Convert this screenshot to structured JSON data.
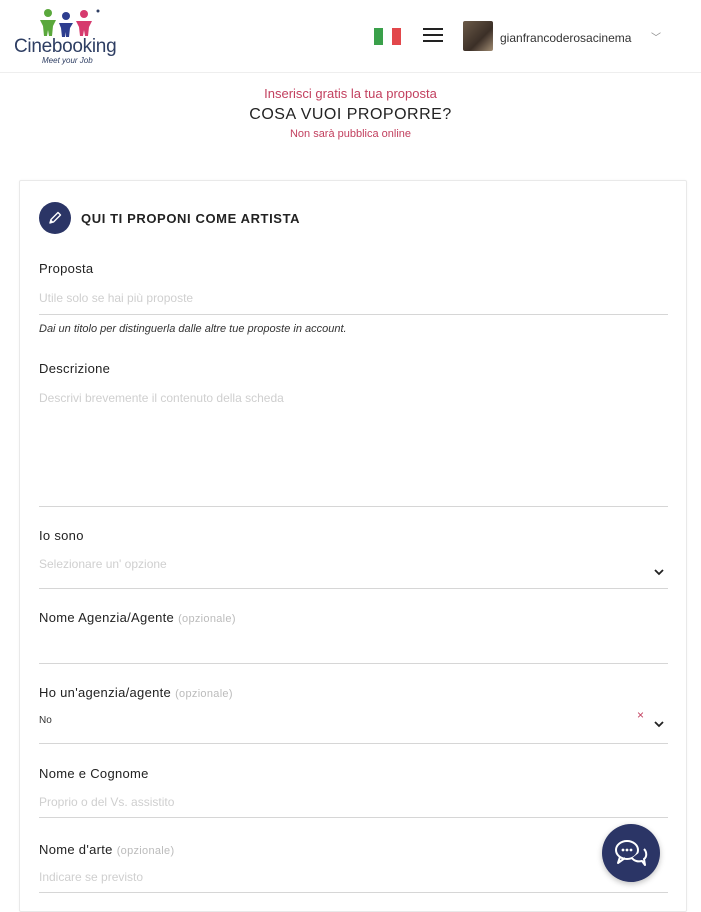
{
  "header": {
    "logo_text": "Cinebooking",
    "logo_tagline": "Meet your Job",
    "username": "gianfrancoderosacinema",
    "flag_colors": [
      "#3aa04a",
      "#ffffff",
      "#e2474b"
    ]
  },
  "intro": {
    "subtitle": "Inserisci gratis la tua proposta",
    "title": "COSA VUOI PROPORRE?",
    "note": "Non sarà pubblica online"
  },
  "form": {
    "section_title": "QUI TI PROPONI COME ARTISTA",
    "proposta": {
      "label": "Proposta",
      "placeholder": "Utile solo se hai più proposte",
      "hint": "Dai un titolo per distinguerla dalle altre tue proposte in account."
    },
    "descrizione": {
      "label": "Descrizione",
      "placeholder": "Descrivi brevemente il contenuto della scheda"
    },
    "io_sono": {
      "label": "Io sono",
      "placeholder": "Selezionare un' opzione"
    },
    "agenzia_nome": {
      "label": "Nome Agenzia/Agente",
      "optional": "(opzionale)"
    },
    "ho_agenzia": {
      "label": "Ho un'agenzia/agente",
      "optional": "(opzionale)",
      "value": "No",
      "clear_symbol": "×"
    },
    "nome_cognome": {
      "label": "Nome e Cognome",
      "placeholder": "Proprio o del Vs. assistito"
    },
    "nome_arte": {
      "label": "Nome d'arte",
      "optional": "(opzionale)",
      "placeholder": "Indicare se previsto"
    }
  },
  "icons": {
    "logo": "people-logo-icon",
    "menu": "hamburger-menu-icon",
    "section": "pencil-icon",
    "chat": "chat-bubbles-icon",
    "select": "chevron-down-icon"
  }
}
